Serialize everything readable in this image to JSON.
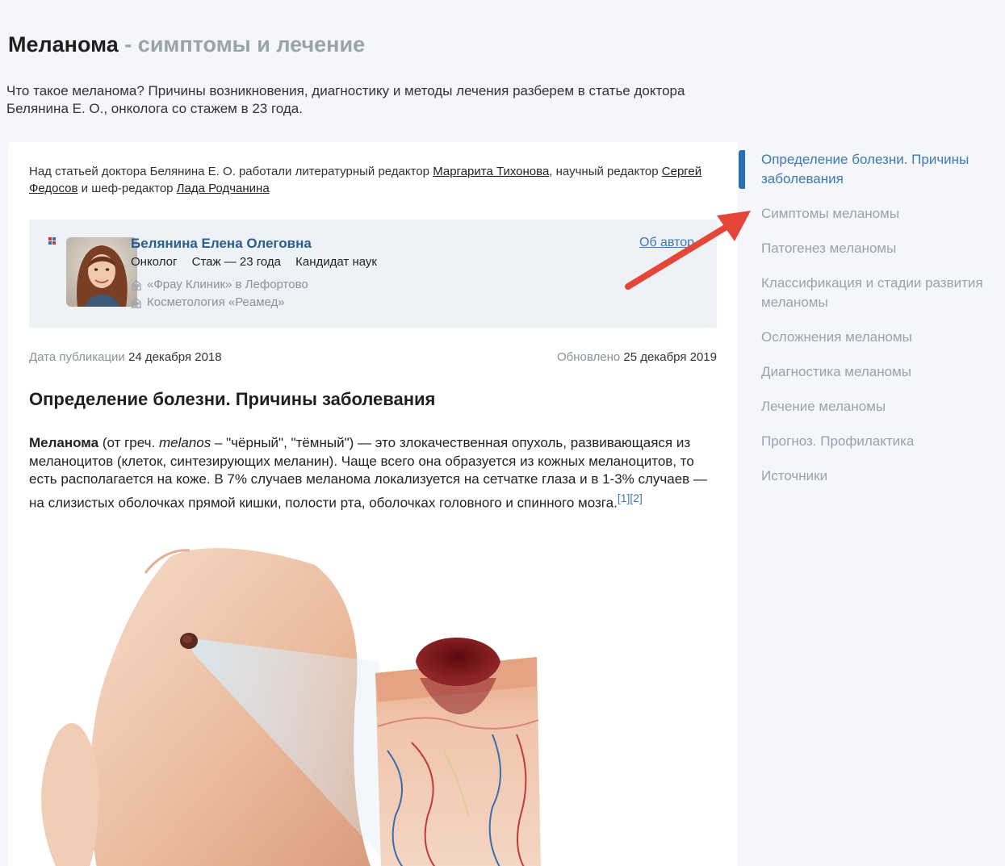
{
  "header": {
    "title": "Меланома",
    "title_separator": "-",
    "title_suffix": "симптомы и лечение",
    "lead": "Что такое меланома? Причины возникновения, диагностику и методы лечения разберем в статье доктора Белянина Е. О., онколога со стажем в 23 года."
  },
  "credits": {
    "prefix": "Над статьей доктора Белянина Е. О. работали литературный редактор",
    "literary_editor": "Маргарита Тихонова",
    "middle": ", научный редактор",
    "science_editor": "Сергей Федосов",
    "and_chief": "и шеф-редактор",
    "chief_editor": "Лада Родчанина"
  },
  "author": {
    "name": "Белянина Елена Олеговна",
    "specialty": "Онколог",
    "experience": "Стаж — 23 года",
    "degree": "Кандидат наук",
    "clinics": [
      "«Фрау Клиник» в Лефортово",
      "Косметология «Реамед»"
    ],
    "about_link": "Об автор"
  },
  "dates": {
    "published_label": "Дата публикации",
    "published": "24 декабря 2018",
    "updated_label": "Обновлено",
    "updated": "25 декабря 2019"
  },
  "article": {
    "section_title": "Определение болезни. Причины заболевания",
    "term": "Меланома",
    "from_greek": "(от греч.",
    "greek_word": "melanos",
    "rest": "– \"чёрный\", \"тёмный\") — это злокачественная опухоль, развивающаяся из меланоцитов (клеток, синтезирующих меланин). Чаще всего она образуется из кожных меланоцитов, то есть располагается на коже. В 7% случаев меланома локализуется на сетчатке глаза и в 1-3% случаев — на слизистых оболочках прямой кишки, полости рта, оболочках головного и спинного мозга.",
    "refs": "[1][2]"
  },
  "toc": {
    "items": [
      "Определение болезни. Причины заболевания",
      "Симптомы меланомы",
      "Патогенез меланомы",
      "Классификация и стадии развития меланомы",
      "Осложнения меланомы",
      "Диагностика меланомы",
      "Лечение меланомы",
      "Прогноз. Профилактика",
      "Источники"
    ]
  },
  "colors": {
    "accent": "#2a6fb1",
    "link": "#3c79b5",
    "muted": "#9aa2ab",
    "arrow": "#e4463a"
  },
  "icons": {
    "clinic": "building-icon",
    "badge": "verified-badge-icon",
    "annotation": "red-arrow-icon"
  }
}
